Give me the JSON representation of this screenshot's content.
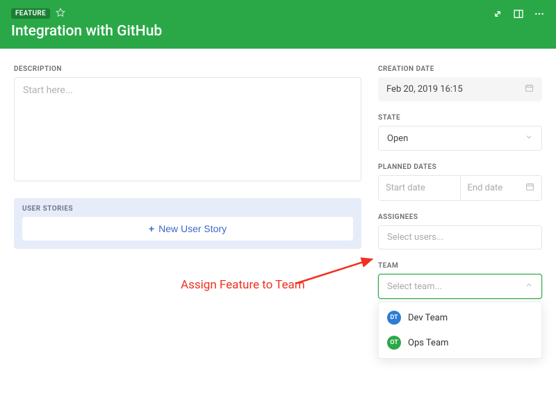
{
  "header": {
    "badge": "FEATURE",
    "title": "Integration with GitHub"
  },
  "description": {
    "label": "DESCRIPTION",
    "placeholder": "Start here..."
  },
  "user_stories": {
    "label": "USER STORIES",
    "new_button": "New User Story"
  },
  "sidebar": {
    "creation_date": {
      "label": "CREATION DATE",
      "value": "Feb 20, 2019 16:15"
    },
    "state": {
      "label": "STATE",
      "value": "Open"
    },
    "planned_dates": {
      "label": "PLANNED DATES",
      "start_placeholder": "Start date",
      "end_placeholder": "End date"
    },
    "assignees": {
      "label": "ASSIGNEES",
      "placeholder": "Select users..."
    },
    "team": {
      "label": "TEAM",
      "placeholder": "Select team...",
      "options": [
        {
          "initials": "DT",
          "name": "Dev Team",
          "color": "blue"
        },
        {
          "initials": "OT",
          "name": "Ops Team",
          "color": "green"
        }
      ]
    }
  },
  "annotation": {
    "text": "Assign Feature to Team"
  }
}
